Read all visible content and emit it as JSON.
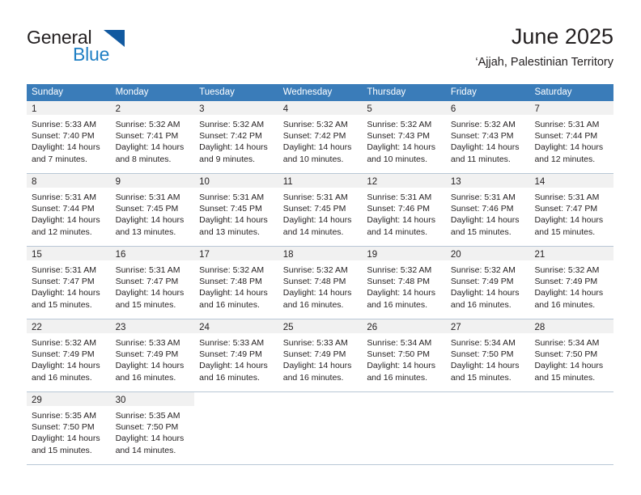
{
  "brand": {
    "name_top": "General",
    "name_bottom": "Blue",
    "accent_color": "#1f7fc4",
    "triangle_color": "#1159a0"
  },
  "header": {
    "title": "June 2025",
    "subtitle": "‘Ajjah, Palestinian Territory"
  },
  "calendar": {
    "header_bg": "#3a7cb9",
    "day_band_bg": "#f1f1f1",
    "row_rule_color": "#b9c7d6",
    "weekdays": [
      "Sunday",
      "Monday",
      "Tuesday",
      "Wednesday",
      "Thursday",
      "Friday",
      "Saturday"
    ],
    "weeks": [
      [
        {
          "day": "1",
          "sunrise": "Sunrise: 5:33 AM",
          "sunset": "Sunset: 7:40 PM",
          "daylight_1": "Daylight: 14 hours",
          "daylight_2": "and 7 minutes."
        },
        {
          "day": "2",
          "sunrise": "Sunrise: 5:32 AM",
          "sunset": "Sunset: 7:41 PM",
          "daylight_1": "Daylight: 14 hours",
          "daylight_2": "and 8 minutes."
        },
        {
          "day": "3",
          "sunrise": "Sunrise: 5:32 AM",
          "sunset": "Sunset: 7:42 PM",
          "daylight_1": "Daylight: 14 hours",
          "daylight_2": "and 9 minutes."
        },
        {
          "day": "4",
          "sunrise": "Sunrise: 5:32 AM",
          "sunset": "Sunset: 7:42 PM",
          "daylight_1": "Daylight: 14 hours",
          "daylight_2": "and 10 minutes."
        },
        {
          "day": "5",
          "sunrise": "Sunrise: 5:32 AM",
          "sunset": "Sunset: 7:43 PM",
          "daylight_1": "Daylight: 14 hours",
          "daylight_2": "and 10 minutes."
        },
        {
          "day": "6",
          "sunrise": "Sunrise: 5:32 AM",
          "sunset": "Sunset: 7:43 PM",
          "daylight_1": "Daylight: 14 hours",
          "daylight_2": "and 11 minutes."
        },
        {
          "day": "7",
          "sunrise": "Sunrise: 5:31 AM",
          "sunset": "Sunset: 7:44 PM",
          "daylight_1": "Daylight: 14 hours",
          "daylight_2": "and 12 minutes."
        }
      ],
      [
        {
          "day": "8",
          "sunrise": "Sunrise: 5:31 AM",
          "sunset": "Sunset: 7:44 PM",
          "daylight_1": "Daylight: 14 hours",
          "daylight_2": "and 12 minutes."
        },
        {
          "day": "9",
          "sunrise": "Sunrise: 5:31 AM",
          "sunset": "Sunset: 7:45 PM",
          "daylight_1": "Daylight: 14 hours",
          "daylight_2": "and 13 minutes."
        },
        {
          "day": "10",
          "sunrise": "Sunrise: 5:31 AM",
          "sunset": "Sunset: 7:45 PM",
          "daylight_1": "Daylight: 14 hours",
          "daylight_2": "and 13 minutes."
        },
        {
          "day": "11",
          "sunrise": "Sunrise: 5:31 AM",
          "sunset": "Sunset: 7:45 PM",
          "daylight_1": "Daylight: 14 hours",
          "daylight_2": "and 14 minutes."
        },
        {
          "day": "12",
          "sunrise": "Sunrise: 5:31 AM",
          "sunset": "Sunset: 7:46 PM",
          "daylight_1": "Daylight: 14 hours",
          "daylight_2": "and 14 minutes."
        },
        {
          "day": "13",
          "sunrise": "Sunrise: 5:31 AM",
          "sunset": "Sunset: 7:46 PM",
          "daylight_1": "Daylight: 14 hours",
          "daylight_2": "and 15 minutes."
        },
        {
          "day": "14",
          "sunrise": "Sunrise: 5:31 AM",
          "sunset": "Sunset: 7:47 PM",
          "daylight_1": "Daylight: 14 hours",
          "daylight_2": "and 15 minutes."
        }
      ],
      [
        {
          "day": "15",
          "sunrise": "Sunrise: 5:31 AM",
          "sunset": "Sunset: 7:47 PM",
          "daylight_1": "Daylight: 14 hours",
          "daylight_2": "and 15 minutes."
        },
        {
          "day": "16",
          "sunrise": "Sunrise: 5:31 AM",
          "sunset": "Sunset: 7:47 PM",
          "daylight_1": "Daylight: 14 hours",
          "daylight_2": "and 15 minutes."
        },
        {
          "day": "17",
          "sunrise": "Sunrise: 5:32 AM",
          "sunset": "Sunset: 7:48 PM",
          "daylight_1": "Daylight: 14 hours",
          "daylight_2": "and 16 minutes."
        },
        {
          "day": "18",
          "sunrise": "Sunrise: 5:32 AM",
          "sunset": "Sunset: 7:48 PM",
          "daylight_1": "Daylight: 14 hours",
          "daylight_2": "and 16 minutes."
        },
        {
          "day": "19",
          "sunrise": "Sunrise: 5:32 AM",
          "sunset": "Sunset: 7:48 PM",
          "daylight_1": "Daylight: 14 hours",
          "daylight_2": "and 16 minutes."
        },
        {
          "day": "20",
          "sunrise": "Sunrise: 5:32 AM",
          "sunset": "Sunset: 7:49 PM",
          "daylight_1": "Daylight: 14 hours",
          "daylight_2": "and 16 minutes."
        },
        {
          "day": "21",
          "sunrise": "Sunrise: 5:32 AM",
          "sunset": "Sunset: 7:49 PM",
          "daylight_1": "Daylight: 14 hours",
          "daylight_2": "and 16 minutes."
        }
      ],
      [
        {
          "day": "22",
          "sunrise": "Sunrise: 5:32 AM",
          "sunset": "Sunset: 7:49 PM",
          "daylight_1": "Daylight: 14 hours",
          "daylight_2": "and 16 minutes."
        },
        {
          "day": "23",
          "sunrise": "Sunrise: 5:33 AM",
          "sunset": "Sunset: 7:49 PM",
          "daylight_1": "Daylight: 14 hours",
          "daylight_2": "and 16 minutes."
        },
        {
          "day": "24",
          "sunrise": "Sunrise: 5:33 AM",
          "sunset": "Sunset: 7:49 PM",
          "daylight_1": "Daylight: 14 hours",
          "daylight_2": "and 16 minutes."
        },
        {
          "day": "25",
          "sunrise": "Sunrise: 5:33 AM",
          "sunset": "Sunset: 7:49 PM",
          "daylight_1": "Daylight: 14 hours",
          "daylight_2": "and 16 minutes."
        },
        {
          "day": "26",
          "sunrise": "Sunrise: 5:34 AM",
          "sunset": "Sunset: 7:50 PM",
          "daylight_1": "Daylight: 14 hours",
          "daylight_2": "and 16 minutes."
        },
        {
          "day": "27",
          "sunrise": "Sunrise: 5:34 AM",
          "sunset": "Sunset: 7:50 PM",
          "daylight_1": "Daylight: 14 hours",
          "daylight_2": "and 15 minutes."
        },
        {
          "day": "28",
          "sunrise": "Sunrise: 5:34 AM",
          "sunset": "Sunset: 7:50 PM",
          "daylight_1": "Daylight: 14 hours",
          "daylight_2": "and 15 minutes."
        }
      ],
      [
        {
          "day": "29",
          "sunrise": "Sunrise: 5:35 AM",
          "sunset": "Sunset: 7:50 PM",
          "daylight_1": "Daylight: 14 hours",
          "daylight_2": "and 15 minutes."
        },
        {
          "day": "30",
          "sunrise": "Sunrise: 5:35 AM",
          "sunset": "Sunset: 7:50 PM",
          "daylight_1": "Daylight: 14 hours",
          "daylight_2": "and 14 minutes."
        },
        {
          "day": "",
          "sunrise": "",
          "sunset": "",
          "daylight_1": "",
          "daylight_2": ""
        },
        {
          "day": "",
          "sunrise": "",
          "sunset": "",
          "daylight_1": "",
          "daylight_2": ""
        },
        {
          "day": "",
          "sunrise": "",
          "sunset": "",
          "daylight_1": "",
          "daylight_2": ""
        },
        {
          "day": "",
          "sunrise": "",
          "sunset": "",
          "daylight_1": "",
          "daylight_2": ""
        },
        {
          "day": "",
          "sunrise": "",
          "sunset": "",
          "daylight_1": "",
          "daylight_2": ""
        }
      ]
    ]
  }
}
